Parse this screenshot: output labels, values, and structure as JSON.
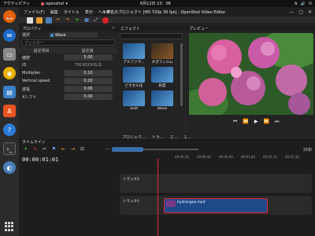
{
  "topbar": {
    "activities": "アクティビティ",
    "app_name": "openshot",
    "clock": "6月12日 23：08"
  },
  "window": {
    "title": "＊無名のプロジェクト [HD 720p 30 fps] - OpenShot Video Editor",
    "menus": [
      "ファイル(F)",
      "編集",
      "タイトル",
      "表示",
      "ヘルプ"
    ]
  },
  "properties": {
    "panel_title": "プロパティ",
    "selection_label": "選択",
    "selection_value": "Wave",
    "filter_placeholder": "フィルター",
    "col_property": "設定項目",
    "col_value": "設定値",
    "rows": [
      {
        "name": "継続",
        "value": "5.00"
      },
      {
        "name": "ID",
        "value": "TRCKOOHSLB"
      },
      {
        "name": "Multiplier",
        "value": "0.10"
      },
      {
        "name": "Vertical speed",
        "value": "0.20"
      },
      {
        "name": "波長",
        "value": "0.06"
      },
      {
        "name": "Xシフト",
        "value": "0.00"
      }
    ]
  },
  "effects": {
    "panel_title": "エフェクト",
    "items": [
      {
        "label": "アルファマ..."
      },
      {
        "label": "ネガフィルム"
      },
      {
        "label": "ピクセル化"
      },
      {
        "label": "彩度"
      },
      {
        "label": "Shift"
      },
      {
        "label": "Wave"
      }
    ],
    "bottom_tabs": [
      "プロジェク...",
      "トラ...",
      "エ...",
      "エ..."
    ]
  },
  "preview": {
    "panel_title": "プレビュー"
  },
  "timeline": {
    "panel_title": "タイムライン",
    "timecode": "00:00:01:01",
    "zoom_label": "15秒",
    "ruler": [
      "00:00:15",
      "00:00:30",
      "00:00:45",
      "00:01:00",
      "00:01:15",
      "00:01:30",
      "00:01:45"
    ],
    "tracks": [
      {
        "label": "トラック2"
      },
      {
        "label": "トラック1"
      }
    ],
    "clip_label": "hydrangea.mp4"
  },
  "colors": {
    "accent": "#3a6fa8",
    "playhead": "#e22233",
    "clip": "#1e4a8a"
  }
}
